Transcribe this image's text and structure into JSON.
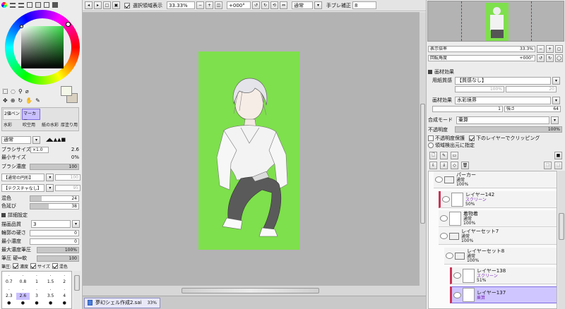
{
  "toolbar": {
    "select_display_label": "選択領域表示",
    "zoom": "33.33%",
    "rotation": "+000°",
    "mode": "通常",
    "stabilizer_label": "手ブレ補正",
    "stabilizer_value": "8"
  },
  "tools": {
    "row1": [
      "2値ペン",
      "マーカー"
    ],
    "row2": [
      "水彩",
      "吹空用",
      "紙の水彩",
      "厚塗り用"
    ],
    "blend_mode": "通常",
    "size_label": "ブラシサイズ",
    "size_multiplier": "×1.0",
    "size_value": "2.6",
    "min_size_label": "最小サイズ",
    "min_size_value": "0%",
    "density_label": "ブラシ濃度",
    "density_value": "100",
    "density_fill": 1.0,
    "shape_select": "【通常の円形】",
    "shape_value": "100",
    "texture_select": "【テクスチャなし】",
    "texture_value": "95",
    "blend_label": "混色",
    "blend_value": "24",
    "blend_fill": 0.24,
    "stretch_label": "色延び",
    "stretch_value": "38",
    "stretch_fill": 0.38,
    "detail_header": "詳細設定",
    "quality_label": "描画品質",
    "quality_value": "3",
    "edge_label": "輪郭の硬さ",
    "edge_value": "0",
    "min_density_label": "最小濃度",
    "min_density_value": "0",
    "max_pressure_label": "最大濃度筆圧",
    "max_pressure_value": "100%",
    "pressure_hard_label": "筆圧 硬⇔軟",
    "pressure_hard_value": "100",
    "pressure_label": "筆圧:",
    "pressure_density": "濃度",
    "pressure_size": "サイズ",
    "pressure_blend": "混色",
    "size_grid": [
      [
        ".",
        ".",
        ".",
        ".",
        "."
      ],
      [
        "0.7",
        "0.8",
        "1",
        "1.5",
        "2"
      ],
      [
        ".",
        ".",
        ".",
        ".",
        "."
      ],
      [
        "2.3",
        "2.6",
        "3",
        "3.5",
        "4"
      ],
      [
        "●",
        "●",
        "●",
        "●",
        "●"
      ]
    ]
  },
  "navigator": {
    "zoom_label": "表示倍率",
    "zoom_value": "33.3%",
    "rotate_label": "回転角度",
    "rotate_value": "+000°"
  },
  "material": {
    "header": "画材効果",
    "paper_label": "用紙質感",
    "paper_value": "【質感なし】",
    "paper_num": "100%",
    "paper_num2": "20",
    "effect_label": "画材効果",
    "effect_value": "水彩境界",
    "effect_v1": "1",
    "effect_v2_label": "強さ",
    "effect_v2": "64"
  },
  "layer_props": {
    "blend_label": "合成モード",
    "blend_value": "乗算",
    "opacity_label": "不透明度",
    "opacity_value": "100%",
    "preserve_label": "不透明度保護",
    "clip_label": "下のレイヤーでクリッピング",
    "source_label": "領域検出元に指定"
  },
  "layers": [
    {
      "name": "パーカー",
      "mode": "通常",
      "opacity": "100%",
      "folder": true
    },
    {
      "name": "レイヤー142",
      "mode": "スクリーン",
      "opacity": "50%",
      "folder": false
    },
    {
      "name": "着物着",
      "mode": "通常",
      "opacity": "100%",
      "folder": false
    },
    {
      "name": "レイヤーセット7",
      "mode": "通常",
      "opacity": "100%",
      "folder": true
    },
    {
      "name": "レイヤーセット8",
      "mode": "通常",
      "opacity": "100%",
      "folder": true
    },
    {
      "name": "レイヤー138",
      "mode": "スクリーン",
      "opacity": "51%",
      "folder": false
    },
    {
      "name": "レイヤー137",
      "mode": "乗算",
      "opacity": "",
      "folder": false
    }
  ],
  "taskbar": {
    "file_name": "夢幻シェル作成2.sai",
    "zoom": "33%"
  },
  "colors": {
    "canvas_bg": "#7ee04c",
    "workspace": "#b3b3b3",
    "accent": "#b0a3ff",
    "clip_red": "#cc3355"
  }
}
